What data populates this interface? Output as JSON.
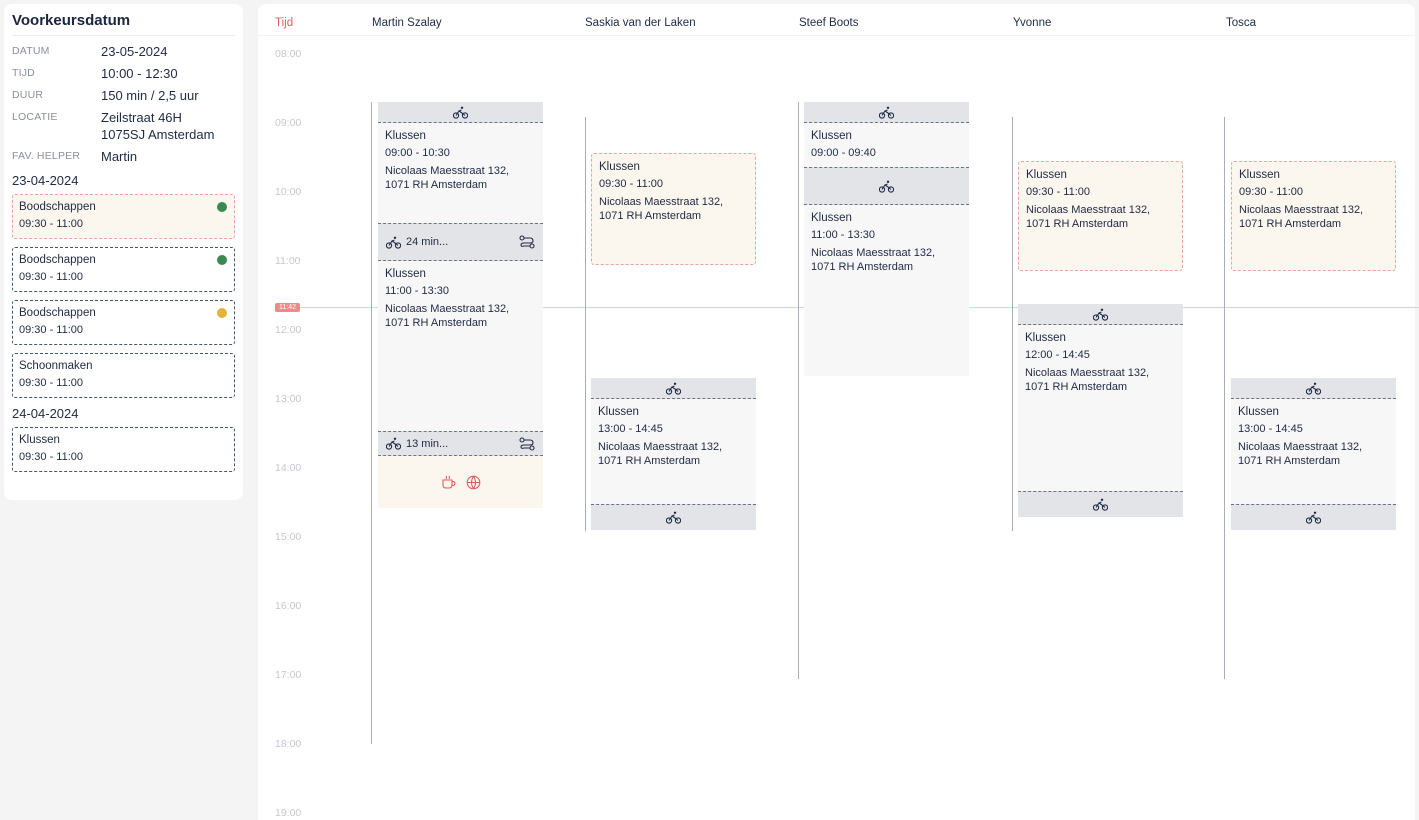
{
  "panel": {
    "title": "Voorkeursdatum",
    "rows": [
      {
        "label": "DATUM",
        "value": "23-05-2024"
      },
      {
        "label": "TIJD",
        "value": "10:00 - 12:30"
      },
      {
        "label": "DUUR",
        "value": "150 min / 2,5 uur"
      },
      {
        "label": "LOCATIE",
        "value": "Zeilstraat 46H\n1075SJ Amsterdam"
      },
      {
        "label": "FAV. HELPER",
        "value": "Martin"
      }
    ],
    "groups": [
      {
        "date": "23-04-2024",
        "cards": [
          {
            "title": "Boodschappen",
            "time": "09:30 - 11:00",
            "dot": "#3a8a4f"
          },
          {
            "title": "Boodschappen",
            "time": "09:30 - 11:00",
            "dot": "#3a8a4f"
          },
          {
            "title": "Boodschappen",
            "time": "09:30 - 11:00",
            "dot": "#e7b23a"
          },
          {
            "title": "Schoonmaken",
            "time": "09:30 - 11:00",
            "dot": ""
          }
        ]
      },
      {
        "date": "24-04-2024",
        "cards": [
          {
            "title": "Klussen",
            "time": "09:30 - 11:00",
            "dot": ""
          }
        ]
      }
    ]
  },
  "calendar": {
    "tijd_label": "Tijd",
    "helpers": [
      "Martin Szalay",
      "Saskia van der Laken",
      "Steef Boots",
      "Yvonne",
      "Tosca"
    ],
    "hours": [
      "08:00",
      "09:00",
      "10:00",
      "11:00",
      "12:00",
      "13:00",
      "14:00",
      "15:00",
      "16:00",
      "17:00",
      "18:00",
      "19:00"
    ],
    "now": "11:42",
    "travel_labels": {
      "martin_1": "24 min...",
      "martin_2": "13 min..."
    },
    "jobs": {
      "martin_1": {
        "title": "Klussen",
        "time": "09:00 - 10:30",
        "address": "Nicolaas Maesstraat 132,\n1071 RH Amsterdam"
      },
      "martin_2": {
        "title": "Klussen",
        "time": "11:00 - 13:30",
        "address": "Nicolaas Maesstraat 132,\n1071 RH Amsterdam"
      },
      "saskia_1": {
        "title": "Klussen",
        "time": "09:30 - 11:00",
        "address": "Nicolaas Maesstraat 132,\n1071 RH Amsterdam"
      },
      "saskia_2": {
        "title": "Klussen",
        "time": "13:00 - 14:45",
        "address": "Nicolaas Maesstraat 132,\n1071 RH Amsterdam"
      },
      "steef_1": {
        "title": "Klussen",
        "time": "09:00 - 09:40",
        "address": ""
      },
      "steef_2": {
        "title": "Klussen",
        "time": "11:00 - 13:30",
        "address": "Nicolaas Maesstraat 132,\n1071 RH Amsterdam"
      },
      "yvonne_1": {
        "title": "Klussen",
        "time": "09:30 - 11:00",
        "address": "Nicolaas Maesstraat 132,\n1071 RH Amsterdam"
      },
      "yvonne_2": {
        "title": "Klussen",
        "time": "12:00 - 14:45",
        "address": "Nicolaas Maesstraat 132,\n1071 RH Amsterdam"
      },
      "tosca_1": {
        "title": "Klussen",
        "time": "09:30 - 11:00",
        "address": "Nicolaas Maesstraat 132,\n1071 RH Amsterdam"
      },
      "tosca_2": {
        "title": "Klussen",
        "time": "13:00 - 14:45",
        "address": "Nicolaas Maesstraat 132,\n1071 RH Amsterdam"
      }
    },
    "icons": {
      "travel": "bike-icon",
      "route": "route-icon",
      "coffee": "coffee-icon",
      "globe": "globe-icon"
    },
    "colors": {
      "accent": "#e05c5c",
      "pending_bg": "#fbf6ee",
      "travel_bg": "#e3e4e8",
      "job_bg": "#f7f7f8"
    }
  }
}
